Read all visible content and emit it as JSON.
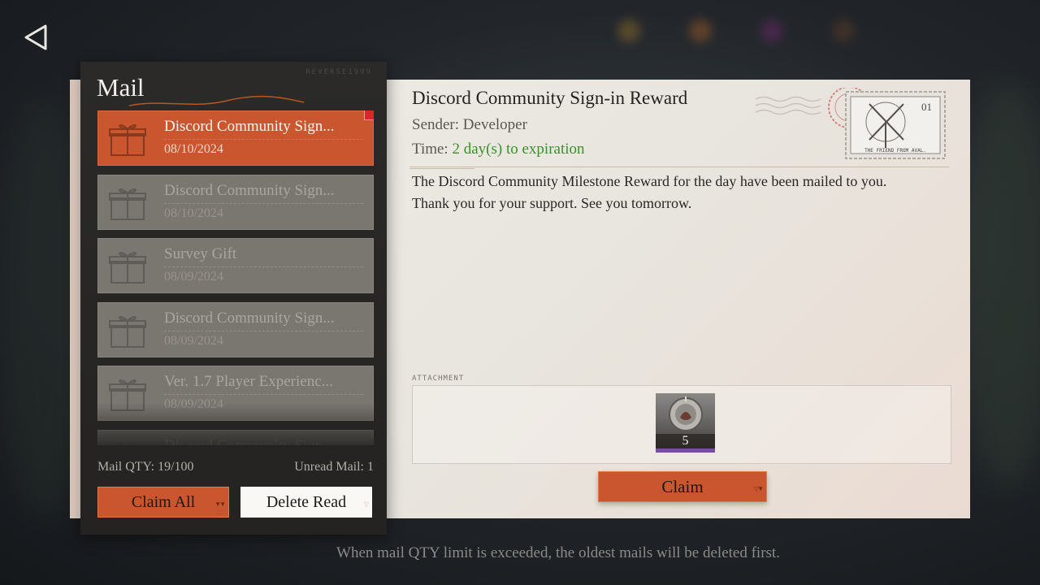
{
  "panel": {
    "title": "Mail",
    "brand": "REVERSE1999",
    "qty_label": "Mail QTY: 19/100",
    "unread_label": "Unread Mail: 1",
    "claim_all_label": "Claim All",
    "delete_read_label": "Delete Read"
  },
  "mails": [
    {
      "subject": "Discord Community Sign...",
      "date": "08/10/2024"
    },
    {
      "subject": "Discord Community Sign...",
      "date": "08/10/2024"
    },
    {
      "subject": "Survey Gift",
      "date": "08/09/2024"
    },
    {
      "subject": "Discord Community Sign...",
      "date": "08/09/2024"
    },
    {
      "subject": "Ver. 1.7 Player Experienc...",
      "date": "08/09/2024"
    },
    {
      "subject": "Discord Community Sign...",
      "date": ""
    }
  ],
  "detail": {
    "title": "Discord Community Sign-in Reward",
    "sender": "Sender: Developer",
    "time_label": "Time: ",
    "time_value": "2 day(s) to expiration",
    "body_line1": "The Discord Community Milestone Reward for the day have been mailed to you.",
    "body_line2": "Thank you for your support. See you tomorrow.",
    "stamp_number": "01",
    "stamp_caption": "THE FRIEND FROM AVAL.",
    "attachment_label": "ATTACHMENT",
    "attachment_qty": "5",
    "claim_label": "Claim"
  },
  "footer": "When mail QTY limit is exceeded, the oldest mails will be deleted first.",
  "colors": {
    "accent": "#c9562e",
    "unread_dot": "#d8262a",
    "expiration": "#3c8f2c"
  }
}
